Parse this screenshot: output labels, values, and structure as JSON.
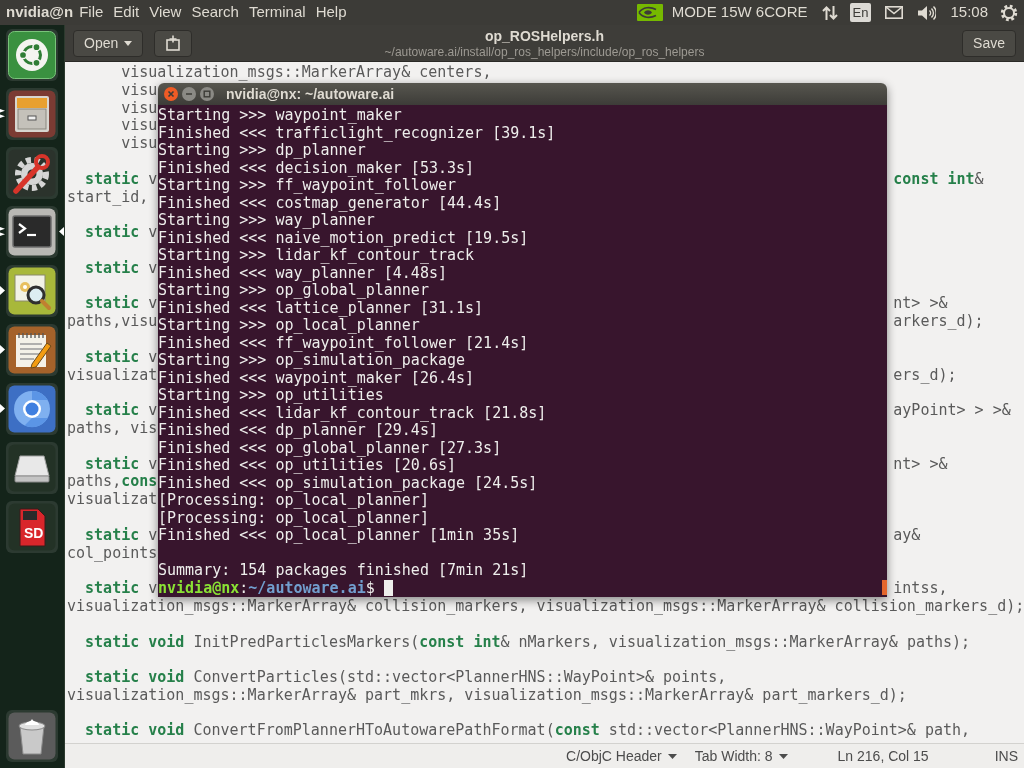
{
  "top_panel": {
    "app_title": "nvidia@n",
    "menus": [
      "File",
      "Edit",
      "View",
      "Search",
      "Terminal",
      "Help"
    ],
    "power_mode": "MODE 15W 6CORE",
    "keyboard_layout": "En",
    "clock": "15:08"
  },
  "launcher": {
    "items": [
      {
        "kind": "ubuntu",
        "running": false,
        "focused": false
      },
      {
        "kind": "files",
        "running": true,
        "multiple_windows": true,
        "focused": false
      },
      {
        "kind": "settings",
        "running": false,
        "focused": false
      },
      {
        "kind": "terminal",
        "running": true,
        "multiple_windows": true,
        "focused": true
      },
      {
        "kind": "image_search",
        "running": true,
        "multiple_windows": false,
        "focused": false
      },
      {
        "kind": "text_editor",
        "running": true,
        "multiple_windows": false,
        "focused": false
      },
      {
        "kind": "browser",
        "running": true,
        "multiple_windows": false,
        "focused": false
      },
      {
        "kind": "drive",
        "running": false,
        "focused": false
      },
      {
        "kind": "sd_card",
        "running": false,
        "focused": false,
        "label": "SD"
      },
      {
        "kind": "trash",
        "running": false,
        "focused": false
      }
    ]
  },
  "editor": {
    "open_button": "Open",
    "title": "op_ROSHelpers.h",
    "subtitle": "~/autoware.ai/install/op_ros_helpers/include/op_ros_helpers",
    "save_button": "Save",
    "blocks": [
      [
        {
          "text": "      visualization_msgs::MarkerArray& centers,"
        },
        {
          "left": "      visu"
        },
        {
          "left": "      visu"
        },
        {
          "left": "      visu"
        },
        {
          "left": "      visu"
        }
      ],
      [
        {
          "left": "  **static** v",
          "right": "**const** **int**&"
        },
        {
          "left": "start_id,"
        }
      ],
      [
        {
          "left": "  **static** v"
        }
      ],
      [
        {
          "left": "  **static** v"
        }
      ],
      [
        {
          "left": "  **static** v",
          "right": "nt> >&"
        },
        {
          "left": "paths,visu",
          "right": "arkers_d);"
        }
      ],
      [
        {
          "left": "  **static** v"
        },
        {
          "left": "visualizat",
          "right": "ers_d);"
        }
      ],
      [
        {
          "left": "  **static** v",
          "right": "ayPoint> > >&"
        },
        {
          "left": "paths, vis"
        }
      ],
      [
        {
          "left": "  **static** v",
          "right": "nt> >&"
        },
        {
          "left": "paths,**cons**"
        },
        {
          "left": "visualizat"
        }
      ],
      [
        {
          "left": "  **static** v",
          "right": "ay&"
        },
        {
          "left": "col_points"
        }
      ],
      [
        {
          "left": "  **static** v",
          "right": "intss,"
        },
        {
          "text": "visualization_msgs::MarkerArray& collision_markers, visualization_msgs::MarkerArray& collision_markers_d);"
        }
      ],
      [
        {
          "text": "  **static** **void** InitPredParticlesMarkers(**const** **int**& nMarkers, visualization_msgs::MarkerArray& paths);"
        }
      ],
      [
        {
          "text": "  **static** **void** ConvertParticles(std::vector<PlannerHNS::WayPoint>& points,"
        },
        {
          "text": "visualization_msgs::MarkerArray& part_mkrs, visualization_msgs::MarkerArray& part_markers_d);"
        }
      ],
      [
        {
          "text": "  **static** **void** ConvertFromPlannerHToAutowarePathFormat(**const** std::vector<PlannerHNS::WayPoint>& path,"
        }
      ]
    ]
  },
  "terminal": {
    "title": "nvidia@nx: ~/autoware.ai",
    "output": [
      "Starting >>> waypoint_maker",
      "Finished <<< trafficlight_recognizer [39.1s]",
      "Starting >>> dp_planner",
      "Finished <<< decision_maker [53.3s]",
      "Starting >>> ff_waypoint_follower",
      "Finished <<< costmap_generator [44.4s]",
      "Starting >>> way_planner",
      "Finished <<< naive_motion_predict [19.5s]",
      "Starting >>> lidar_kf_contour_track",
      "Finished <<< way_planner [4.48s]",
      "Starting >>> op_global_planner",
      "Finished <<< lattice_planner [31.1s]",
      "Starting >>> op_local_planner",
      "Finished <<< ff_waypoint_follower [21.4s]",
      "Starting >>> op_simulation_package",
      "Finished <<< waypoint_maker [26.4s]",
      "Starting >>> op_utilities",
      "Finished <<< lidar_kf_contour_track [21.8s]",
      "Finished <<< dp_planner [29.4s]",
      "Finished <<< op_global_planner [27.3s]",
      "Finished <<< op_utilities [20.6s]",
      "Finished <<< op_simulation_package [24.5s]",
      "[Processing: op_local_planner]",
      "[Processing: op_local_planner]",
      "Finished <<< op_local_planner [1min 35s]"
    ],
    "summary": "Summary: 154 packages finished [7min 21s]",
    "prompt": {
      "user_host": "nvidia@nx",
      "separator": ":",
      "path": "~/autoware.ai",
      "symbol": "$"
    }
  },
  "status_bar": {
    "language": "C/ObjC Header",
    "tab_width": "Tab Width: 8",
    "position": "Ln 216, Col 15",
    "mode": "INS"
  }
}
